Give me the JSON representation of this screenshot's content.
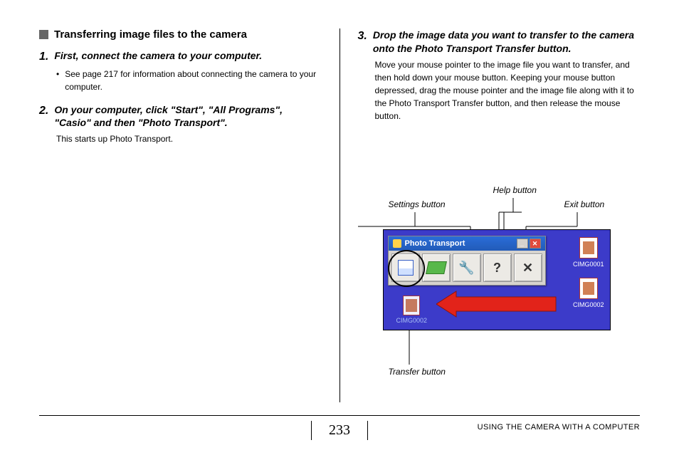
{
  "heading": "Transferring image files to the camera",
  "steps": [
    {
      "num": "1.",
      "title": "First, connect the camera to your computer.",
      "bullet": "See page 217 for information about connecting the camera to your computer."
    },
    {
      "num": "2.",
      "title": "On your computer, click \"Start\", \"All Programs\", \"Casio\" and then \"Photo Transport\".",
      "body": "This starts up Photo Transport."
    },
    {
      "num": "3.",
      "title": "Drop the image data you want to transfer to the camera onto the Photo Transport Transfer button.",
      "body": "Move your mouse pointer to the image file you want to transfer, and then hold down your mouse button. Keeping your mouse button depressed, drag the mouse pointer and the image file along with it to the Photo Transport Transfer button, and then release the mouse button."
    }
  ],
  "labels": {
    "settings": "Settings button",
    "help": "Help button",
    "exit": "Exit button",
    "transfer": "Transfer button"
  },
  "shot": {
    "window_title": "Photo Transport",
    "win_min": "_",
    "win_close": "✕",
    "btn_settings": "🔧",
    "btn_help": "?",
    "btn_exit": "✕",
    "file1": "CIMG0001",
    "file2": "CIMG0002",
    "dragged": "CIMG0002"
  },
  "footer": {
    "page": "233",
    "section": "USING THE CAMERA WITH A COMPUTER"
  }
}
